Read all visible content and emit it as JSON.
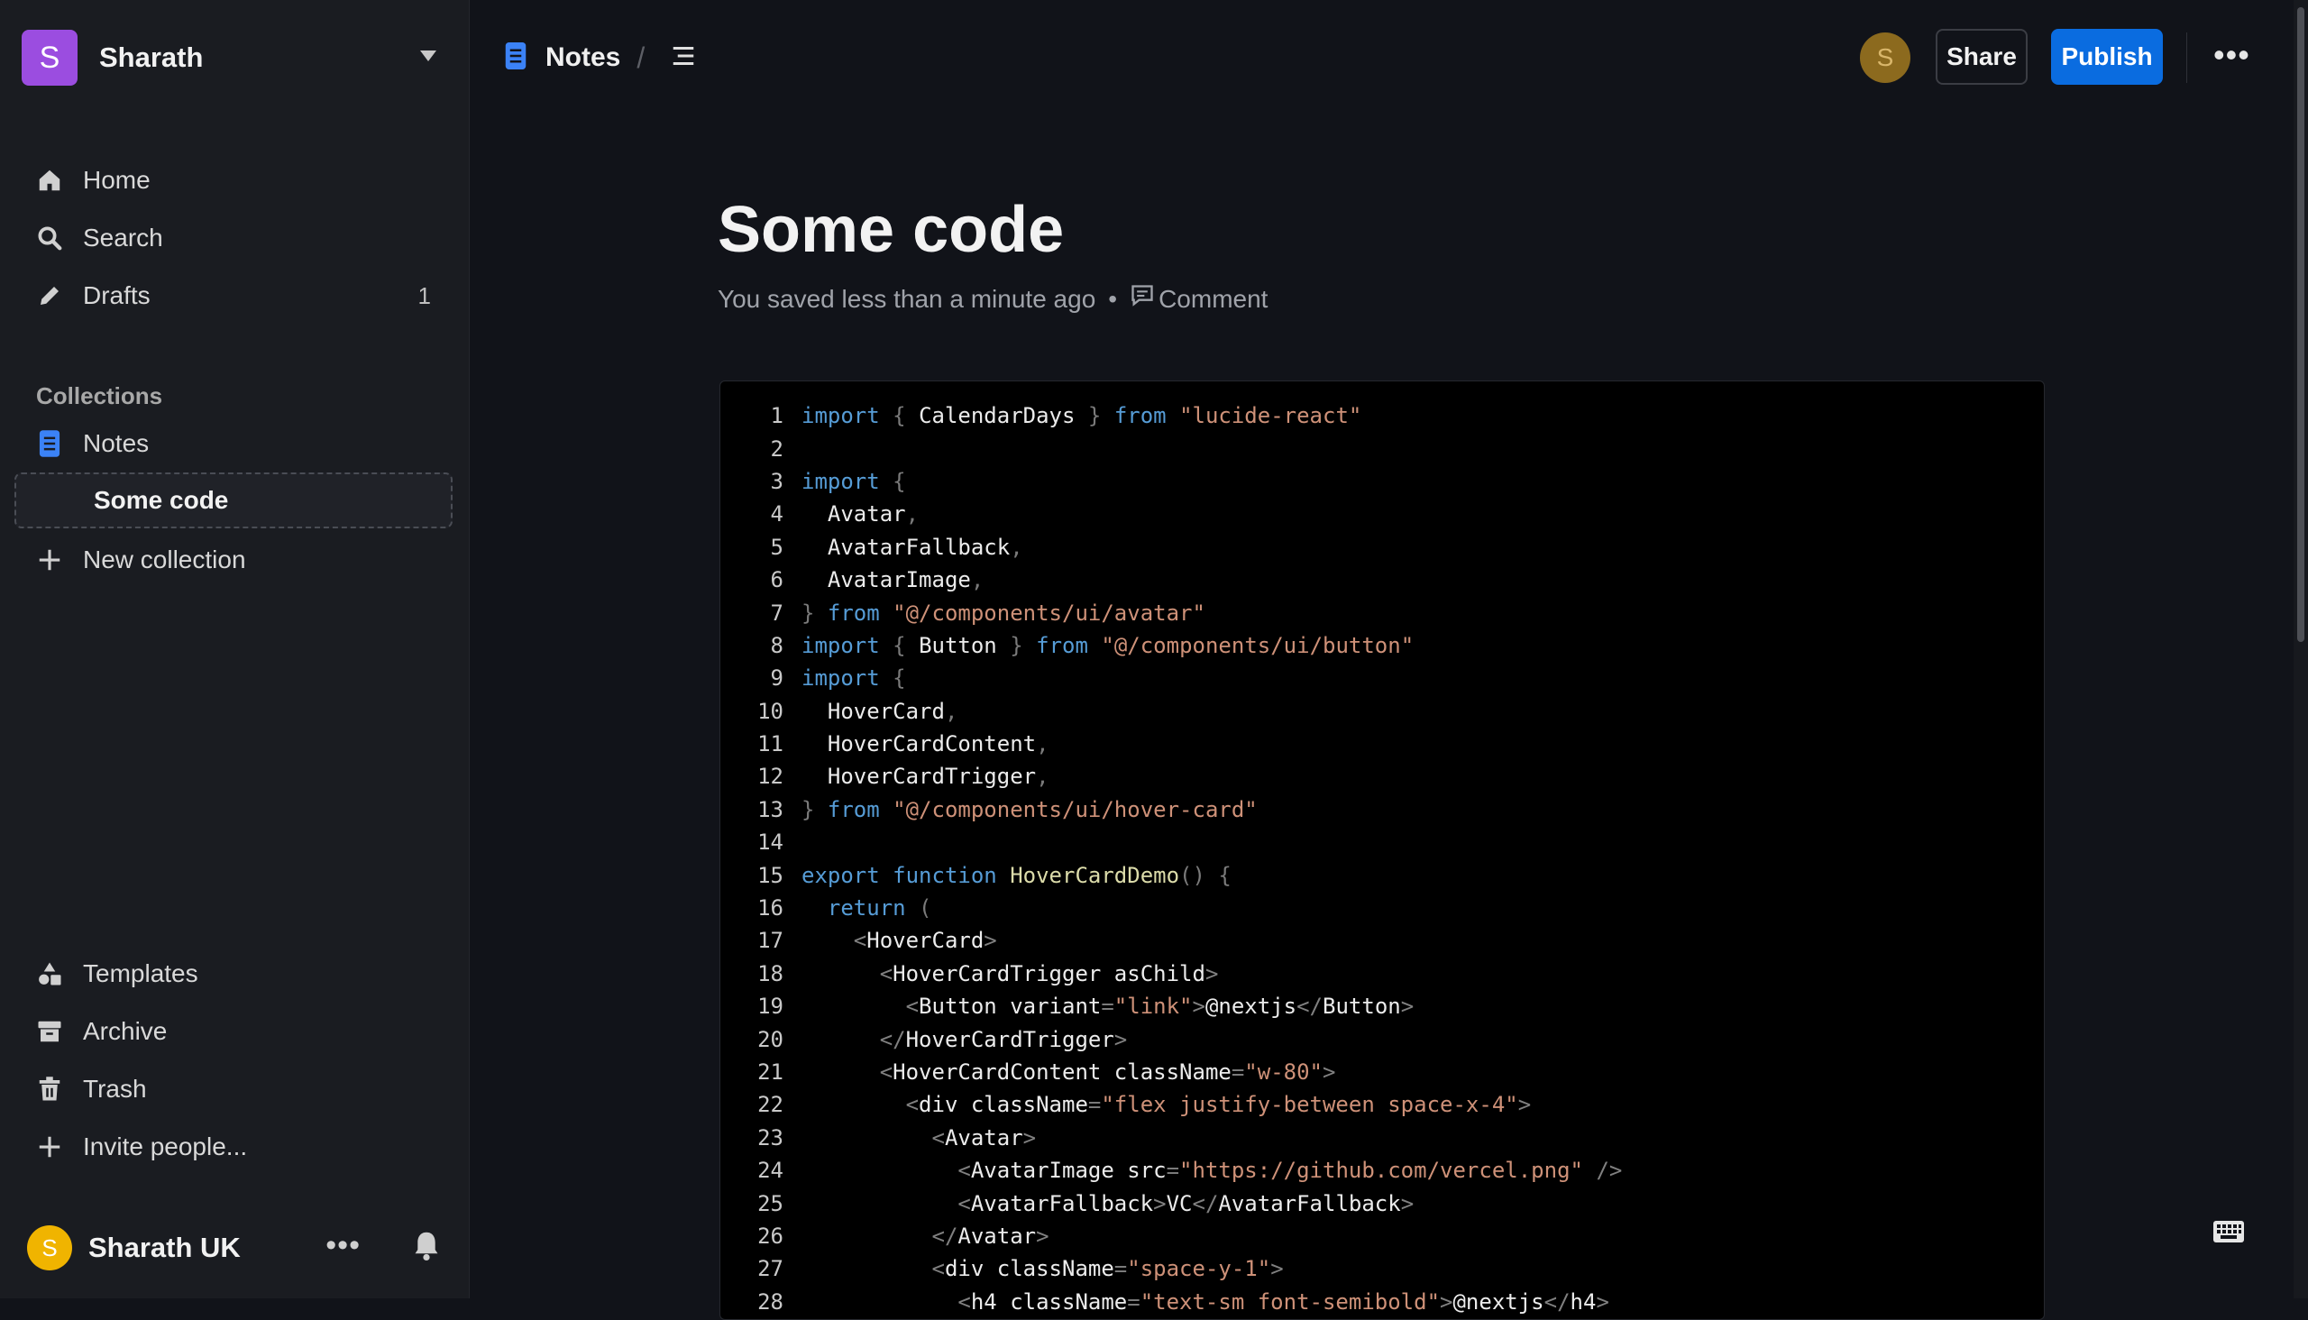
{
  "workspace": {
    "initial": "S",
    "name": "Sharath"
  },
  "nav": {
    "home": "Home",
    "search": "Search",
    "drafts": "Drafts",
    "drafts_count": "1"
  },
  "collections": {
    "label": "Collections",
    "notes": "Notes",
    "active_doc": "Some code",
    "new_collection": "New collection"
  },
  "footer_nav": {
    "templates": "Templates",
    "archive": "Archive",
    "trash": "Trash",
    "invite": "Invite people..."
  },
  "user": {
    "initial": "S",
    "name": "Sharath UK",
    "more": "•••"
  },
  "header": {
    "collection": "Notes",
    "separator": "/",
    "avatar_initial": "S",
    "share": "Share",
    "publish": "Publish",
    "more": "•••"
  },
  "document": {
    "title": "Some code",
    "saved": "You saved less than a minute ago",
    "dot": "•",
    "comment": "Comment"
  },
  "colors": {
    "accent": "#0a6ce0",
    "workspace_avatar": "#9b4de0",
    "user_avatar": "#f0b400",
    "background": "#111319",
    "sidebar": "#1a1c21"
  },
  "code": [
    [
      [
        "kw",
        "import"
      ],
      [
        "pn",
        " { "
      ],
      [
        "ct",
        "CalendarDays"
      ],
      [
        "pn",
        " } "
      ],
      [
        "kw",
        "from"
      ],
      [
        "ct",
        " "
      ],
      [
        "str",
        "\"lucide-react\""
      ]
    ],
    [],
    [
      [
        "kw",
        "import"
      ],
      [
        "pn",
        " {"
      ]
    ],
    [
      [
        "ct",
        "  Avatar"
      ],
      [
        "pn",
        ","
      ]
    ],
    [
      [
        "ct",
        "  AvatarFallback"
      ],
      [
        "pn",
        ","
      ]
    ],
    [
      [
        "ct",
        "  AvatarImage"
      ],
      [
        "pn",
        ","
      ]
    ],
    [
      [
        "pn",
        "} "
      ],
      [
        "kw",
        "from"
      ],
      [
        "ct",
        " "
      ],
      [
        "str",
        "\"@/components/ui/avatar\""
      ]
    ],
    [
      [
        "kw",
        "import"
      ],
      [
        "pn",
        " { "
      ],
      [
        "ct",
        "Button"
      ],
      [
        "pn",
        " } "
      ],
      [
        "kw",
        "from"
      ],
      [
        "ct",
        " "
      ],
      [
        "str",
        "\"@/components/ui/button\""
      ]
    ],
    [
      [
        "kw",
        "import"
      ],
      [
        "pn",
        " {"
      ]
    ],
    [
      [
        "ct",
        "  HoverCard"
      ],
      [
        "pn",
        ","
      ]
    ],
    [
      [
        "ct",
        "  HoverCardContent"
      ],
      [
        "pn",
        ","
      ]
    ],
    [
      [
        "ct",
        "  HoverCardTrigger"
      ],
      [
        "pn",
        ","
      ]
    ],
    [
      [
        "pn",
        "} "
      ],
      [
        "kw",
        "from"
      ],
      [
        "ct",
        " "
      ],
      [
        "str",
        "\"@/components/ui/hover-card\""
      ]
    ],
    [],
    [
      [
        "kw",
        "export"
      ],
      [
        "ct",
        " "
      ],
      [
        "kw",
        "function"
      ],
      [
        "ct",
        " "
      ],
      [
        "fn",
        "HoverCardDemo"
      ],
      [
        "pn",
        "() {"
      ]
    ],
    [
      [
        "ct",
        "  "
      ],
      [
        "kw",
        "return"
      ],
      [
        "pn",
        " ("
      ]
    ],
    [
      [
        "ct",
        "    "
      ],
      [
        "tg",
        "<"
      ],
      [
        "ct",
        "HoverCard"
      ],
      [
        "tg",
        ">"
      ]
    ],
    [
      [
        "ct",
        "      "
      ],
      [
        "tg",
        "<"
      ],
      [
        "ct",
        "HoverCardTrigger asChild"
      ],
      [
        "tg",
        ">"
      ]
    ],
    [
      [
        "ct",
        "        "
      ],
      [
        "tg",
        "<"
      ],
      [
        "ct",
        "Button variant"
      ],
      [
        "pn",
        "="
      ],
      [
        "str",
        "\"link\""
      ],
      [
        "tg",
        ">"
      ],
      [
        "ct",
        "@nextjs"
      ],
      [
        "tg",
        "</"
      ],
      [
        "ct",
        "Button"
      ],
      [
        "tg",
        ">"
      ]
    ],
    [
      [
        "ct",
        "      "
      ],
      [
        "tg",
        "</"
      ],
      [
        "ct",
        "HoverCardTrigger"
      ],
      [
        "tg",
        ">"
      ]
    ],
    [
      [
        "ct",
        "      "
      ],
      [
        "tg",
        "<"
      ],
      [
        "ct",
        "HoverCardContent className"
      ],
      [
        "pn",
        "="
      ],
      [
        "str",
        "\"w-80\""
      ],
      [
        "tg",
        ">"
      ]
    ],
    [
      [
        "ct",
        "        "
      ],
      [
        "tg",
        "<"
      ],
      [
        "ct",
        "div className"
      ],
      [
        "pn",
        "="
      ],
      [
        "str",
        "\"flex justify-between space-x-4\""
      ],
      [
        "tg",
        ">"
      ]
    ],
    [
      [
        "ct",
        "          "
      ],
      [
        "tg",
        "<"
      ],
      [
        "ct",
        "Avatar"
      ],
      [
        "tg",
        ">"
      ]
    ],
    [
      [
        "ct",
        "            "
      ],
      [
        "tg",
        "<"
      ],
      [
        "ct",
        "AvatarImage src"
      ],
      [
        "pn",
        "="
      ],
      [
        "str",
        "\"https://github.com/vercel.png\""
      ],
      [
        "ct",
        " "
      ],
      [
        "tg",
        "/>"
      ]
    ],
    [
      [
        "ct",
        "            "
      ],
      [
        "tg",
        "<"
      ],
      [
        "ct",
        "AvatarFallback"
      ],
      [
        "tg",
        ">"
      ],
      [
        "ct",
        "VC"
      ],
      [
        "tg",
        "</"
      ],
      [
        "ct",
        "AvatarFallback"
      ],
      [
        "tg",
        ">"
      ]
    ],
    [
      [
        "ct",
        "          "
      ],
      [
        "tg",
        "</"
      ],
      [
        "ct",
        "Avatar"
      ],
      [
        "tg",
        ">"
      ]
    ],
    [
      [
        "ct",
        "          "
      ],
      [
        "tg",
        "<"
      ],
      [
        "ct",
        "div className"
      ],
      [
        "pn",
        "="
      ],
      [
        "str",
        "\"space-y-1\""
      ],
      [
        "tg",
        ">"
      ]
    ],
    [
      [
        "ct",
        "            "
      ],
      [
        "tg",
        "<"
      ],
      [
        "ct",
        "h4 className"
      ],
      [
        "pn",
        "="
      ],
      [
        "str",
        "\"text-sm font-semibold\""
      ],
      [
        "tg",
        ">"
      ],
      [
        "ct",
        "@nextjs"
      ],
      [
        "tg",
        "</"
      ],
      [
        "ct",
        "h4"
      ],
      [
        "tg",
        ">"
      ]
    ]
  ]
}
